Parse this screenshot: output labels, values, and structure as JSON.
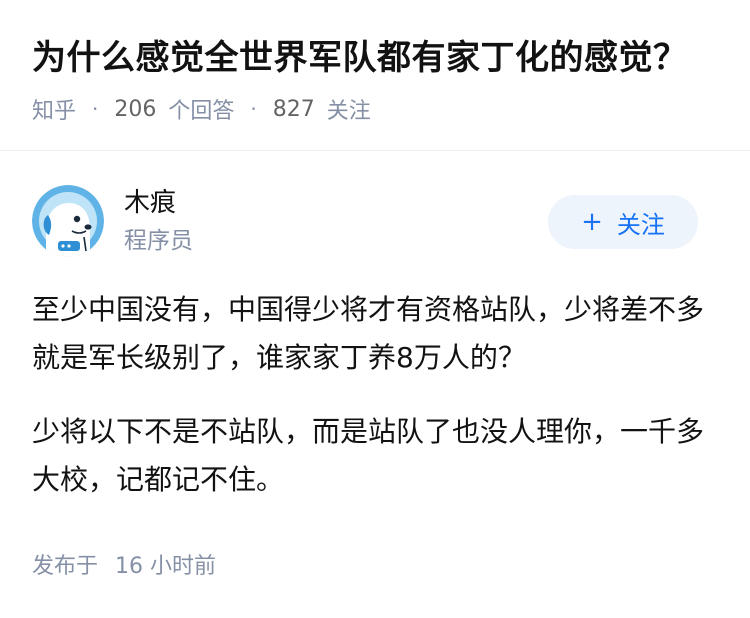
{
  "question": {
    "title": "为什么感觉全世界军队都有家丁化的感觉？",
    "source": "知乎",
    "answer_count": "206",
    "answer_label": "个回答",
    "follower_count": "827",
    "follower_label": "关注",
    "separator": "·"
  },
  "answer": {
    "author": {
      "name": "木痕",
      "headline": "程序员",
      "avatar_icon": "blue-cartoon-dog-avatar"
    },
    "follow_button": {
      "icon": "+",
      "label": "关注"
    },
    "paragraphs": [
      "至少中国没有，中国得少将才有资格站队，少将差不多就是军长级别了，谁家家丁养8万人的？",
      "少将以下不是不站队，而是站队了也没人理你，一千多大校，记都记不住。"
    ],
    "publish": {
      "label": "发布于",
      "time": "16 小时前"
    }
  },
  "colors": {
    "text": "#121212",
    "meta": "#8590a6",
    "accent": "#1772f6",
    "follow_bg": "#eef4fb"
  }
}
